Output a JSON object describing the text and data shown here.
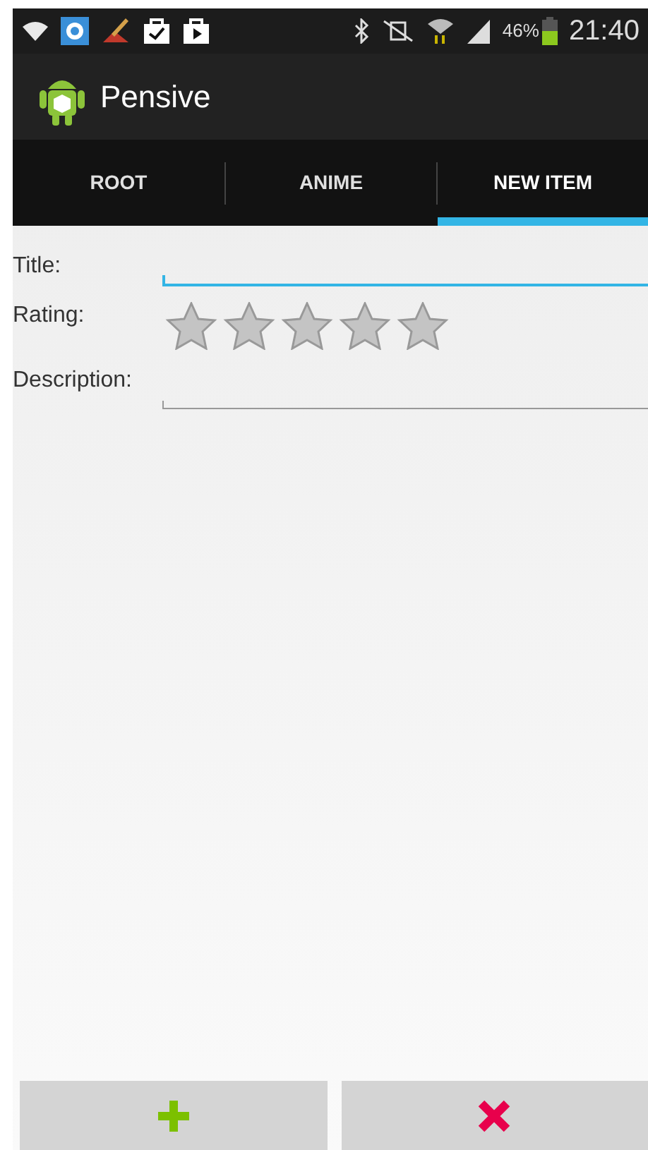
{
  "status_bar": {
    "battery": "46%",
    "time": "21:40"
  },
  "action_bar": {
    "title": "Pensive"
  },
  "tabs": [
    {
      "label": "ROOT",
      "selected": false
    },
    {
      "label": "ANIME",
      "selected": false
    },
    {
      "label": "NEW ITEM",
      "selected": true
    }
  ],
  "form": {
    "title": {
      "label": "Title:"
    },
    "rating": {
      "label": "Rating:",
      "stars": 0
    },
    "description": {
      "label": "Description:"
    }
  },
  "buttons": [
    {
      "kind": "add"
    },
    {
      "kind": "cancel"
    }
  ]
}
